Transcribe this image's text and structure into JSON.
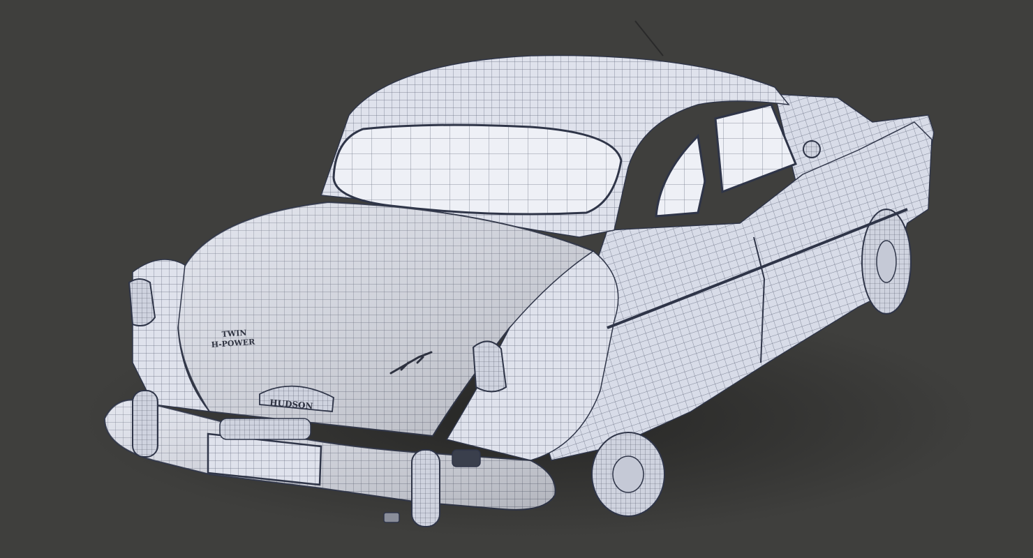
{
  "scene": {
    "subject": "car-wireframe-render",
    "background_color": "#3f3f3d",
    "body_color": "#dfe2ec",
    "wire_color": "#3b4258"
  },
  "badges": {
    "trunk_script_top": "TWIN",
    "trunk_script_bottom": "H-POWER",
    "plate_text": "HUDSON"
  }
}
